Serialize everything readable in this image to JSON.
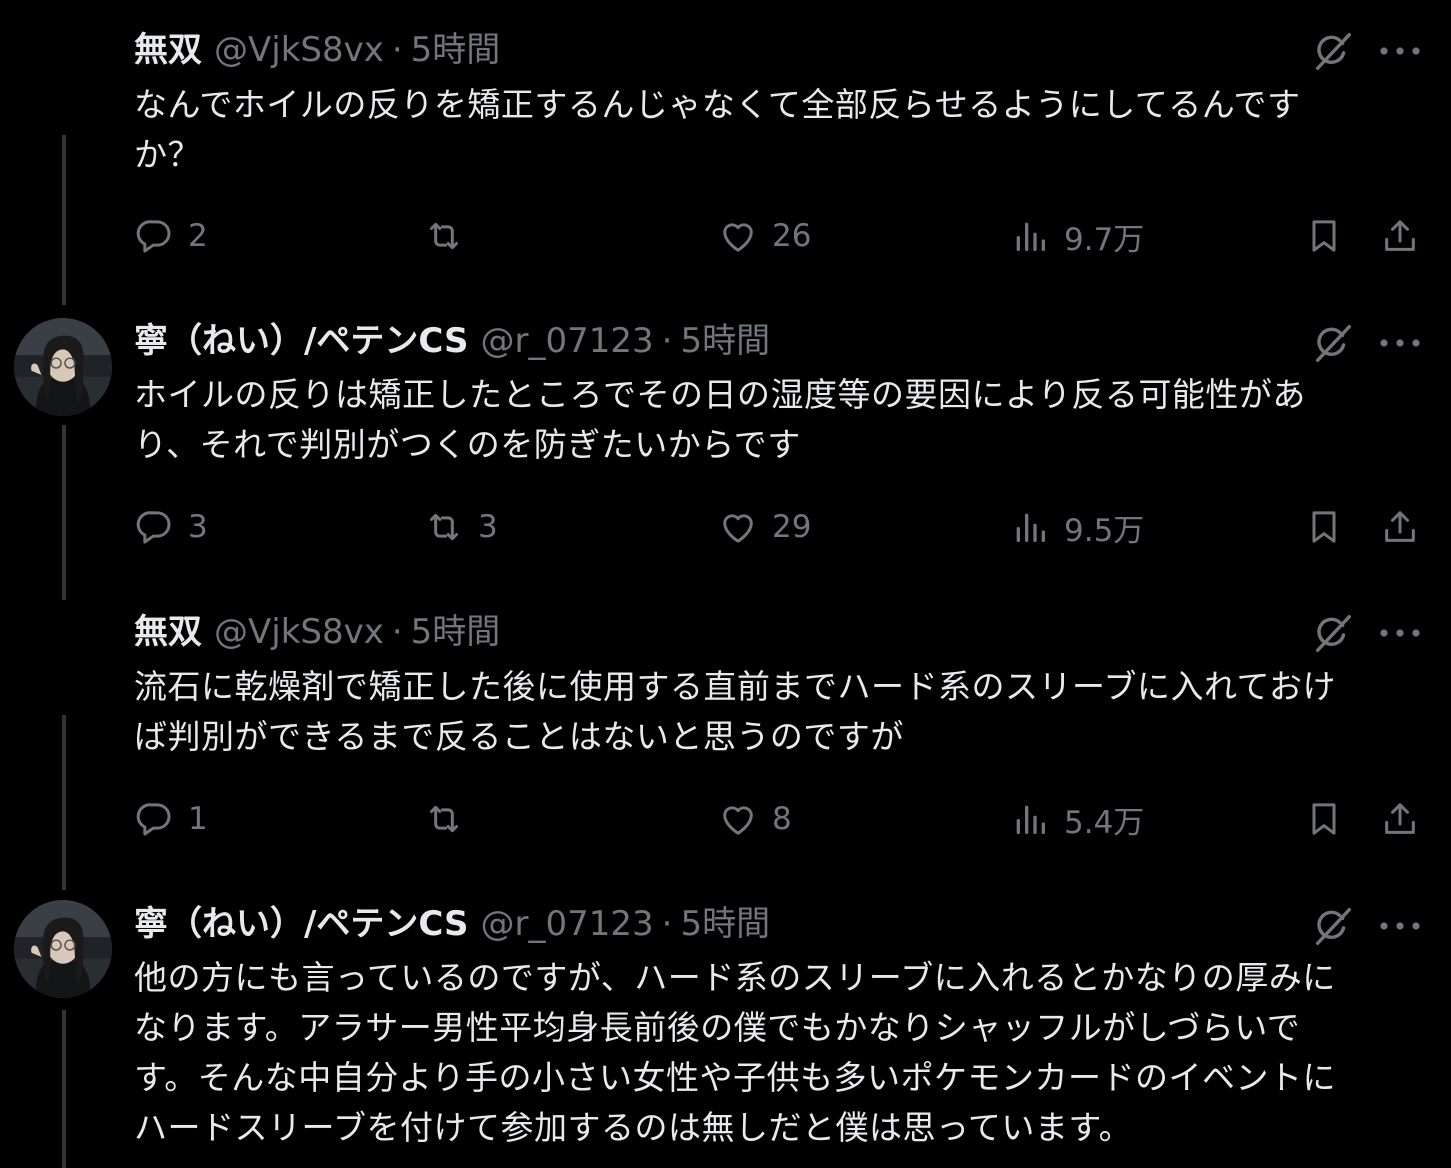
{
  "tweets": [
    {
      "name": "無双",
      "handle": "@VjkS8vx",
      "separator": "·",
      "time": "5時間",
      "text_lines": [
        "なんでホイルの反りを矯正するんじゃなくて全部反らせるようにしてるんです",
        "か？"
      ],
      "replies": "2",
      "retweets": "",
      "likes": "26",
      "views": "9.7万",
      "has_avatar": false
    },
    {
      "name": "寧（ねい）/ペテンCS",
      "handle": "@r_07123",
      "separator": "·",
      "time": "5時間",
      "text_lines": [
        "ホイルの反りは矯正したところでその日の湿度等の要因により反る可能性があ",
        "り、それで判別がつくのを防ぎたいからです"
      ],
      "replies": "3",
      "retweets": "3",
      "likes": "29",
      "views": "9.5万",
      "has_avatar": true
    },
    {
      "name": "無双",
      "handle": "@VjkS8vx",
      "separator": "·",
      "time": "5時間",
      "text_lines": [
        "流石に乾燥剤で矯正した後に使用する直前までハード系のスリーブに入れておけ",
        "ば判別ができるまで反ることはないと思うのですが"
      ],
      "replies": "1",
      "retweets": "",
      "likes": "8",
      "views": "5.4万",
      "has_avatar": false
    },
    {
      "name": "寧（ねい）/ペテンCS",
      "handle": "@r_07123",
      "separator": "·",
      "time": "5時間",
      "text_lines": [
        "他の方にも言っているのですが、ハード系のスリーブに入れるとかなりの厚みに",
        "なります。アラサー男性平均身長前後の僕でもかなりシャッフルがしづらいで",
        "す。そんな中自分より手の小さい女性や子供も多いポケモンカードのイベントに",
        "ハードスリーブを付けて参加するのは無しだと僕は思っています。"
      ],
      "has_avatar": true
    }
  ],
  "icons": {
    "reply": "reply-icon",
    "retweet": "retweet-icon",
    "like": "heart-icon",
    "views": "views-icon",
    "bookmark": "bookmark-icon",
    "share": "share-icon",
    "grok": "grok-icon",
    "more": "more-icon"
  },
  "colors": {
    "background": "#000000",
    "text": "#e7e9ea",
    "muted": "#71767b",
    "thread_line": "#333639"
  }
}
